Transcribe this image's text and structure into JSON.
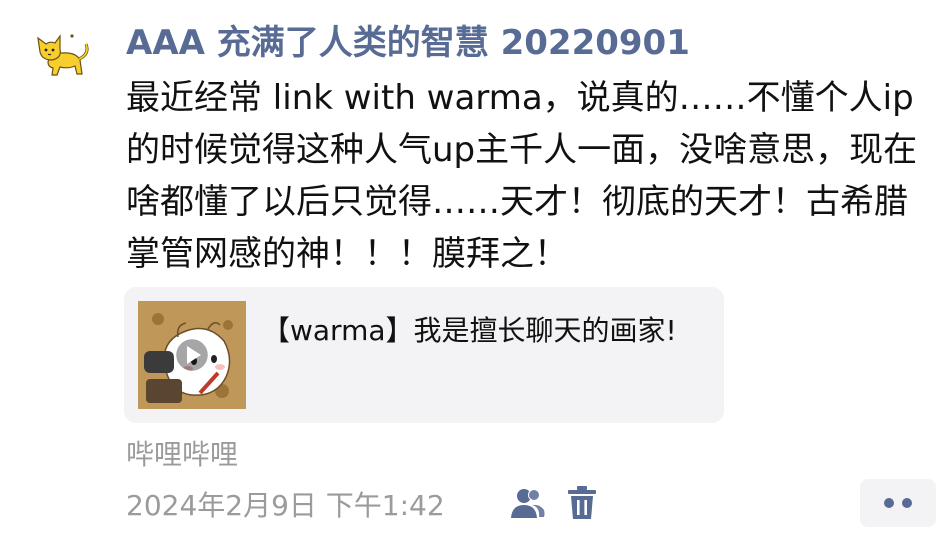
{
  "post": {
    "author": "AAA 充满了人类的智慧 20220901",
    "content": "最近经常 link with warma，说真的……不懂个人ip的时候觉得这种人气up主千人一面，没啥意思，现在啥都懂了以后只觉得……天才！彻底的天才！古希腊掌管网感的神！！！膜拜之！",
    "avatar_icon": "yellow-cat-avatar"
  },
  "link_card": {
    "title": "【warma】我是擅长聊天的画家!",
    "thumbnail_icon": "video-thumbnail"
  },
  "meta": {
    "source": "哔哩哔哩",
    "timestamp": "2024年2月9日 下午1:42",
    "visibility_icon": "people-icon",
    "delete_icon": "trash-icon",
    "more_icon": "more-dots-icon"
  },
  "colors": {
    "name": "#576b95",
    "meta": "#9b9b9b",
    "card_bg": "#f3f3f5"
  }
}
